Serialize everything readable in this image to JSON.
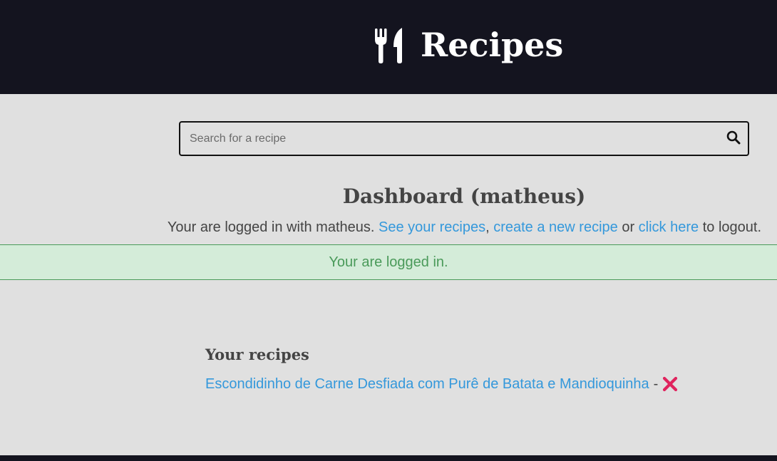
{
  "header": {
    "title": "Recipes",
    "logo_icon": "utensils-icon"
  },
  "search": {
    "placeholder": "Search for a recipe",
    "value": "",
    "button_icon": "search-icon"
  },
  "dashboard": {
    "title": "Dashboard (matheus)",
    "intro": "Your are logged in with matheus. ",
    "see_recipes_link": "See your recipes",
    "comma": ", ",
    "create_recipe_link": "create a new recipe",
    "or_text": " or ",
    "logout_link": "click here",
    "logout_suffix": " to logout."
  },
  "alert": {
    "message": "Your are logged in.",
    "color": "#4a9a5a"
  },
  "recipes": {
    "title": "Your recipes",
    "items": [
      {
        "name": "Escondidinho de Carne Desfiada com Purê de Batata e Mandioquinha",
        "separator": "-",
        "delete_icon": "cross-mark-icon"
      }
    ]
  },
  "colors": {
    "header_bg": "#14141f",
    "page_bg": "#e0e0e0",
    "link": "#3498db",
    "delete": "#e0245e"
  }
}
